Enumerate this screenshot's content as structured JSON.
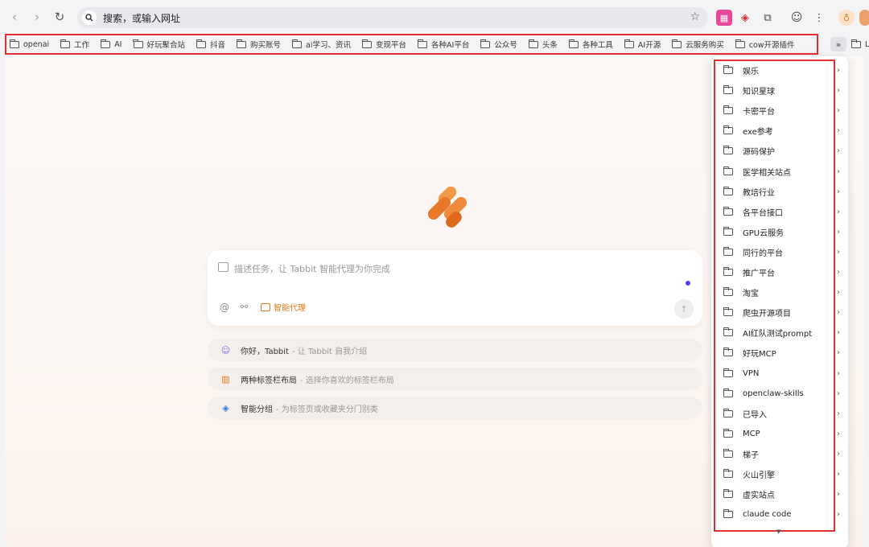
{
  "toolbar": {
    "back": "‹",
    "forward": "›",
    "reload": "↻",
    "omnibox_text": "搜索，或输入网址"
  },
  "bookmarks": [
    {
      "label": "openai"
    },
    {
      "label": "工作"
    },
    {
      "label": "AI"
    },
    {
      "label": "好玩聚合站"
    },
    {
      "label": "抖音"
    },
    {
      "label": "购买账号"
    },
    {
      "label": "ai学习、资讯"
    },
    {
      "label": "变现平台"
    },
    {
      "label": "各种AI平台"
    },
    {
      "label": "公众号"
    },
    {
      "label": "头条"
    },
    {
      "label": "各种工具"
    },
    {
      "label": "AI开源"
    },
    {
      "label": "云服务购买"
    },
    {
      "label": "cow开源插件"
    }
  ],
  "bookmarks_more": "»",
  "bookmarks_edge_label": "L",
  "task": {
    "placeholder": "描述任务，让 Tabbit 智能代理为你完成",
    "at": "@",
    "agent_label": "智能代理"
  },
  "suggestions": [
    {
      "title": "你好，Tabbit",
      "sub": "- 让 Tabbit 自我介绍",
      "icon": "smile-icon",
      "color": "#7b6cf0"
    },
    {
      "title": "两种标签栏布局",
      "sub": "- 选择你喜欢的标签栏布局",
      "icon": "layout-icon",
      "color": "#e07a1c"
    },
    {
      "title": "智能分组",
      "sub": "- 为标签页或收藏夹分门别类",
      "icon": "layers-icon",
      "color": "#3a7bd5"
    }
  ],
  "dropdown_items": [
    {
      "label": "娱乐"
    },
    {
      "label": "知识星球"
    },
    {
      "label": "卡密平台"
    },
    {
      "label": "exe参考"
    },
    {
      "label": "源码保护"
    },
    {
      "label": "医学相关站点"
    },
    {
      "label": "教培行业"
    },
    {
      "label": "各平台接口"
    },
    {
      "label": "GPU云服务"
    },
    {
      "label": "同行的平台"
    },
    {
      "label": "推广平台"
    },
    {
      "label": "淘宝"
    },
    {
      "label": "爬虫开源项目"
    },
    {
      "label": "AI红队测试prompt"
    },
    {
      "label": "好玩MCP"
    },
    {
      "label": "VPN"
    },
    {
      "label": "openclaw-skills"
    },
    {
      "label": "已导入"
    },
    {
      "label": "MCP"
    },
    {
      "label": "梯子"
    },
    {
      "label": "火山引擎"
    },
    {
      "label": "虚实站点"
    },
    {
      "label": "claude code"
    }
  ],
  "colors": {
    "highlight": "#e03030",
    "accent_orange": "#e07a1c",
    "accent_purple": "#5a3cf0"
  }
}
